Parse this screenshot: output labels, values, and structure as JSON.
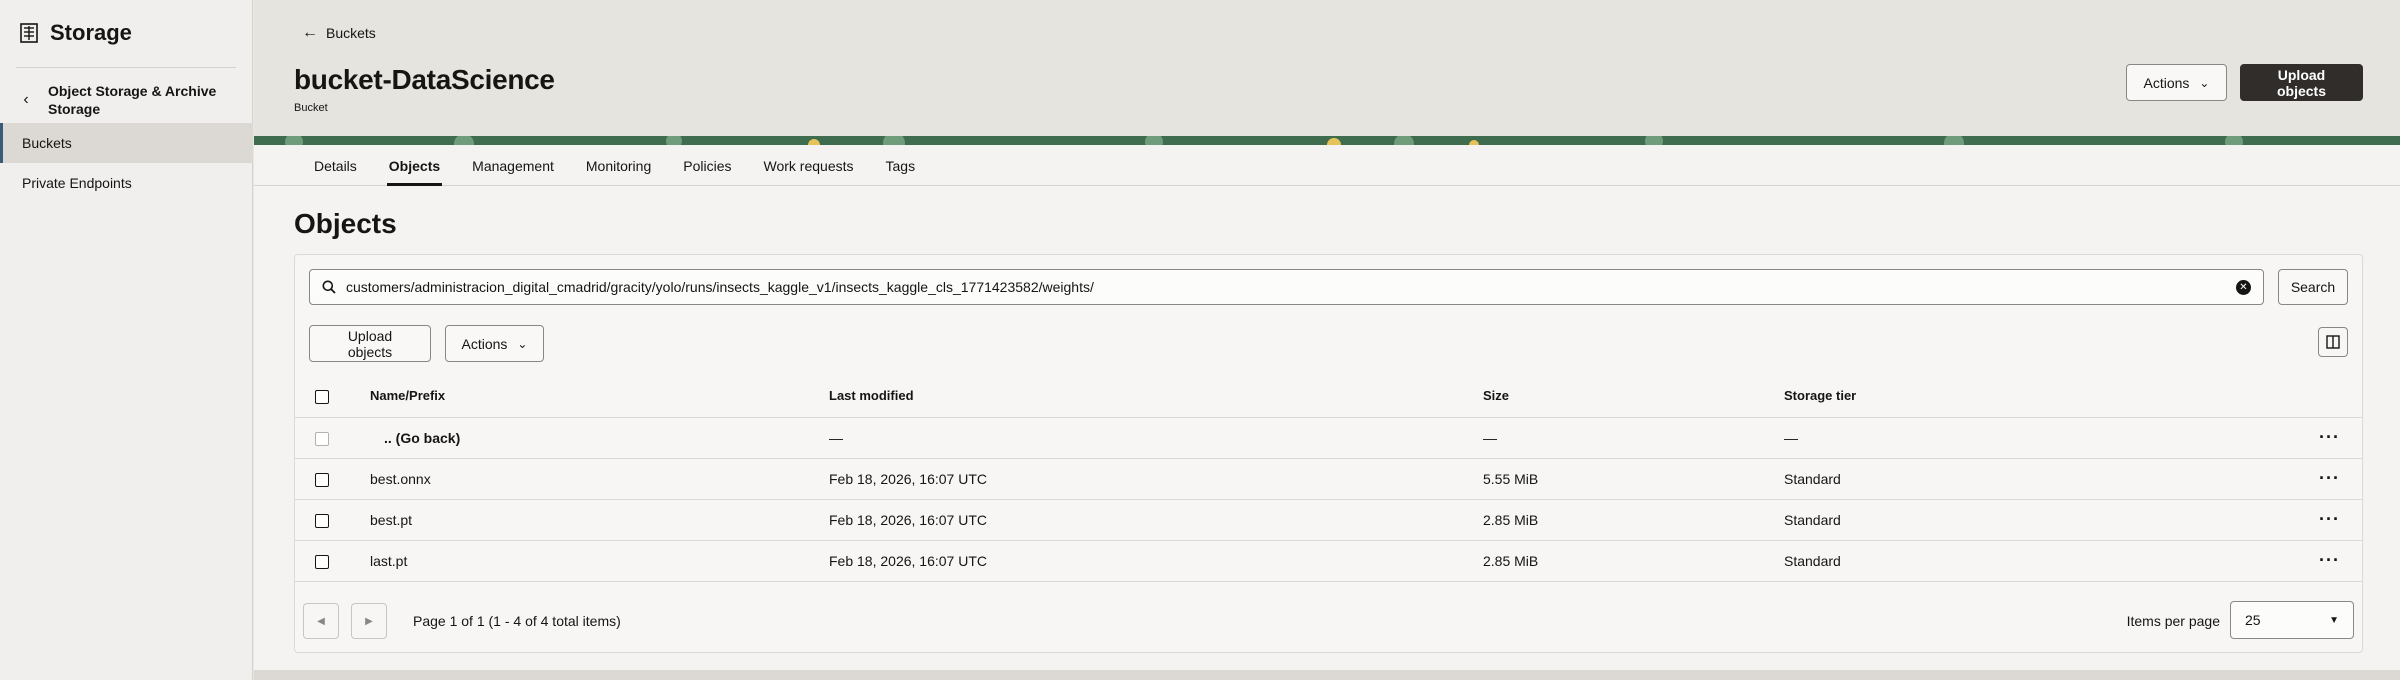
{
  "sidebar": {
    "title": "Storage",
    "back_label": "Object Storage & Archive Storage",
    "items": [
      {
        "label": "Buckets",
        "active": true
      },
      {
        "label": "Private Endpoints",
        "active": false
      }
    ]
  },
  "header": {
    "back_link": "Buckets",
    "title": "bucket-DataScience",
    "subtitle": "Bucket",
    "actions_label": "Actions",
    "upload_label": "Upload objects"
  },
  "tabs": [
    "Details",
    "Objects",
    "Management",
    "Monitoring",
    "Policies",
    "Work requests",
    "Tags"
  ],
  "active_tab": "Objects",
  "objects": {
    "heading": "Objects",
    "search_value": "customers/administracion_digital_cmadrid/gracity/yolo/runs/insects_kaggle_v1/insects_kaggle_cls_1771423582/weights/",
    "search_button": "Search",
    "upload_button": "Upload objects",
    "actions_button": "Actions",
    "columns": [
      "Name/Prefix",
      "Last modified",
      "Size",
      "Storage tier"
    ],
    "rows": [
      {
        "name": ".. (Go back)",
        "modified": "—",
        "size": "—",
        "tier": "—",
        "parent": true
      },
      {
        "name": "best.onnx",
        "modified": "Feb 18, 2026, 16:07 UTC",
        "size": "5.55 MiB",
        "tier": "Standard"
      },
      {
        "name": "best.pt",
        "modified": "Feb 18, 2026, 16:07 UTC",
        "size": "2.85 MiB",
        "tier": "Standard"
      },
      {
        "name": "last.pt",
        "modified": "Feb 18, 2026, 16:07 UTC",
        "size": "2.85 MiB",
        "tier": "Standard"
      }
    ],
    "page_info": "Page 1 of 1 (1 - 4 of 4 total items)",
    "items_per_page_label": "Items per page",
    "items_per_page": "25"
  },
  "colors": {
    "accent_dark": "#312d2a",
    "banner_green": "#3f6b4f",
    "banner_yellow": "#e6c35a"
  }
}
